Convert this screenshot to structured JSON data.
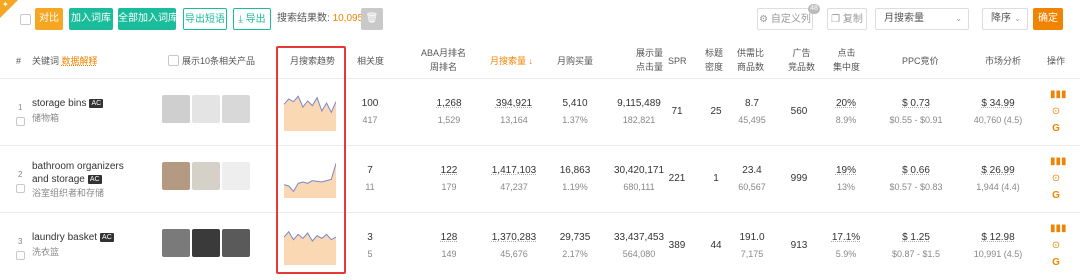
{
  "toolbar": {
    "compare": "对比",
    "add_to_list": "加入词库",
    "add_all_to_list": "全部加入词库",
    "export_phrases": "导出短语",
    "export": "导出",
    "result_label": "搜索结果数:",
    "result_count": "10,095",
    "custom_columns": "自定义列",
    "custom_badge": "48",
    "copy": "复制",
    "sort_field": "月搜索量",
    "sort_order": "降序",
    "confirm": "确定"
  },
  "header": {
    "index": "#",
    "keyword": "关键词",
    "data_explain": "数据解释",
    "show_products": "展示10条相关产品",
    "trend": "月搜索趋势",
    "relevance": "相关度",
    "aba_rank": "ABA月排名",
    "aba_rank_2": "周排名",
    "monthly_search": "月搜索量",
    "monthly_purchase": "月购买量",
    "impressions": "展示量",
    "clicks": "点击量",
    "spr": "SPR",
    "title_density": "标题",
    "title_density_2": "密度",
    "supply_demand": "供需比",
    "product_count": "商品数",
    "ad_products": "广告",
    "ad_products_2": "竞品数",
    "click_concentration": "点击",
    "click_concentration_2": "集中度",
    "ppc": "PPC竞价",
    "market": "市场分析",
    "ops": "操作"
  },
  "rows": [
    {
      "num": "1",
      "keyword": "storage bins",
      "ac": "AC",
      "keyword_cn": "储物箱",
      "relevance": "100",
      "relevance_sub": "417",
      "aba_rank": "1,268",
      "week_rank": "1,529",
      "monthly_search": "394,921",
      "search_sub": "13,164",
      "monthly_purchase": "5,410",
      "purchase_rate": "1.37%",
      "impressions": "9,115,489",
      "clicks": "182,821",
      "spr": "71",
      "title_density": "25",
      "supply_ratio": "8.7",
      "product_count": "45,495",
      "ad_products": "560",
      "click_conc": "20%",
      "click_conc_sub": "8.9%",
      "ppc": "$ 0.73",
      "ppc_range": "$0.55 - $0.91",
      "market_price": "$ 34.99",
      "market_sub": "40,760 (4.5)",
      "trend": [
        40,
        48,
        44,
        52,
        36,
        45,
        38,
        50,
        30,
        42,
        28,
        44
      ]
    },
    {
      "num": "2",
      "keyword": "bathroom organizers and storage",
      "ac": "AC",
      "keyword_cn": "浴室组织者和存储",
      "relevance": "7",
      "relevance_sub": "11",
      "aba_rank": "122",
      "week_rank": "179",
      "monthly_search": "1,417,103",
      "search_sub": "47,237",
      "monthly_purchase": "16,863",
      "purchase_rate": "1.19%",
      "impressions": "30,420,171",
      "clicks": "680,111",
      "spr": "221",
      "title_density": "1",
      "supply_ratio": "23.4",
      "product_count": "60,567",
      "ad_products": "999",
      "click_conc": "19%",
      "click_conc_sub": "13%",
      "ppc": "$ 0.66",
      "ppc_range": "$0.57 - $0.83",
      "market_price": "$ 26.99",
      "market_sub": "1,944 (4.4)",
      "trend": [
        20,
        18,
        10,
        22,
        24,
        22,
        26,
        25,
        24,
        26,
        28,
        52
      ]
    },
    {
      "num": "3",
      "keyword": "laundry basket",
      "ac": "AC",
      "keyword_cn": "洗衣篮",
      "relevance": "3",
      "relevance_sub": "5",
      "aba_rank": "128",
      "week_rank": "149",
      "monthly_search": "1,370,283",
      "search_sub": "45,676",
      "monthly_purchase": "29,735",
      "purchase_rate": "2.17%",
      "impressions": "33,437,453",
      "clicks": "564,080",
      "spr": "389",
      "title_density": "44",
      "supply_ratio": "191.0",
      "product_count": "7,175",
      "ad_products": "913",
      "click_conc": "17.1%",
      "click_conc_sub": "5.9%",
      "ppc": "$ 1.25",
      "ppc_range": "$0.87 - $1.5",
      "market_price": "$ 12.98",
      "market_sub": "10,991 (4.5)",
      "trend": [
        42,
        50,
        38,
        46,
        40,
        48,
        36,
        44,
        40,
        46,
        38,
        42
      ]
    }
  ],
  "colors": {
    "accent": "#f08300",
    "teal": "#1bbc9b",
    "highlight": "#e53935",
    "spark_line": "#7986cb",
    "spark_fill": "#fbd8b4"
  }
}
